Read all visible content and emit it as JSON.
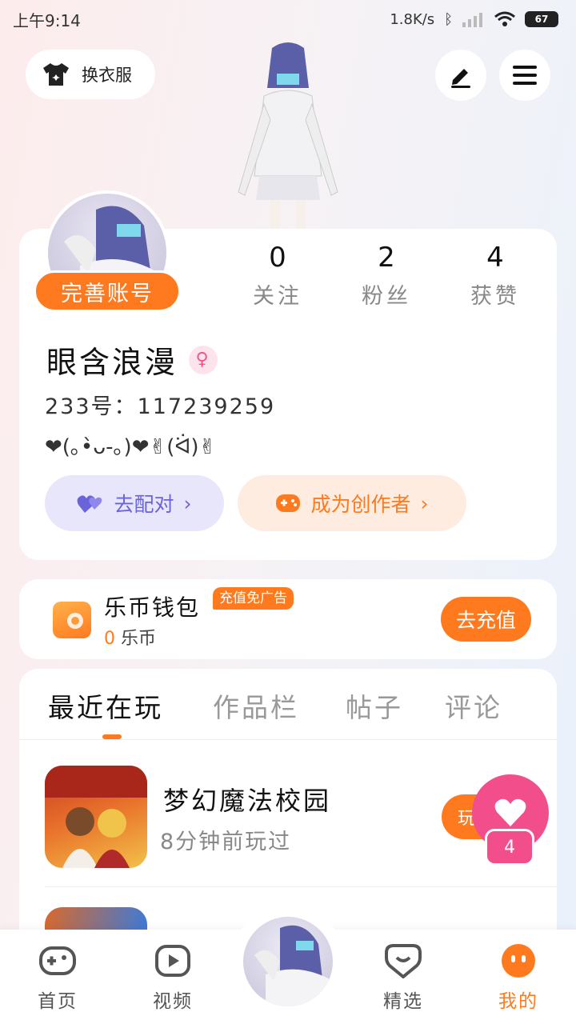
{
  "status_bar": {
    "time": "上午9:14",
    "net_speed": "1.8K/s",
    "battery": "67"
  },
  "header": {
    "outfit_label": "换衣服",
    "icons": [
      "shirt-icon",
      "edit-icon",
      "menu-icon"
    ]
  },
  "profile": {
    "complete_label": "完善账号",
    "stats": [
      {
        "value": "0",
        "label": "关注"
      },
      {
        "value": "2",
        "label": "粉丝"
      },
      {
        "value": "4",
        "label": "获赞"
      }
    ],
    "name": "眼含浪漫",
    "gender_symbol": "♀",
    "id_line": "233号：117239259",
    "bio": "❤(｡•̀ᴗ-｡)❤✌(ᐛ)✌",
    "pair_label": "去配对",
    "creator_label": "成为创作者"
  },
  "wallet": {
    "title": "乐币钱包",
    "badge": "充值免广告",
    "balance_value": "0",
    "balance_unit": "乐币",
    "recharge_label": "去充值"
  },
  "tabs": [
    {
      "label": "最近在玩",
      "active": true
    },
    {
      "label": "作品栏",
      "active": false
    },
    {
      "label": "帖子",
      "active": false
    },
    {
      "label": "评论",
      "active": false
    }
  ],
  "recent_games": [
    {
      "title": "梦幻魔法校园",
      "played": "8分钟前玩过",
      "play_label": "玩"
    }
  ],
  "like_count": "4",
  "bottom_nav": [
    {
      "label": "首页",
      "icon": "gamepad-icon",
      "active": false
    },
    {
      "label": "视频",
      "icon": "play-icon",
      "active": false
    },
    {
      "label": "精选",
      "icon": "heart-chat-icon",
      "active": false
    },
    {
      "label": "我的",
      "icon": "face-icon",
      "active": true
    }
  ],
  "colors": {
    "accent": "#ff7a1f",
    "pink": "#f24e8b",
    "purple": "#6b63d9"
  }
}
